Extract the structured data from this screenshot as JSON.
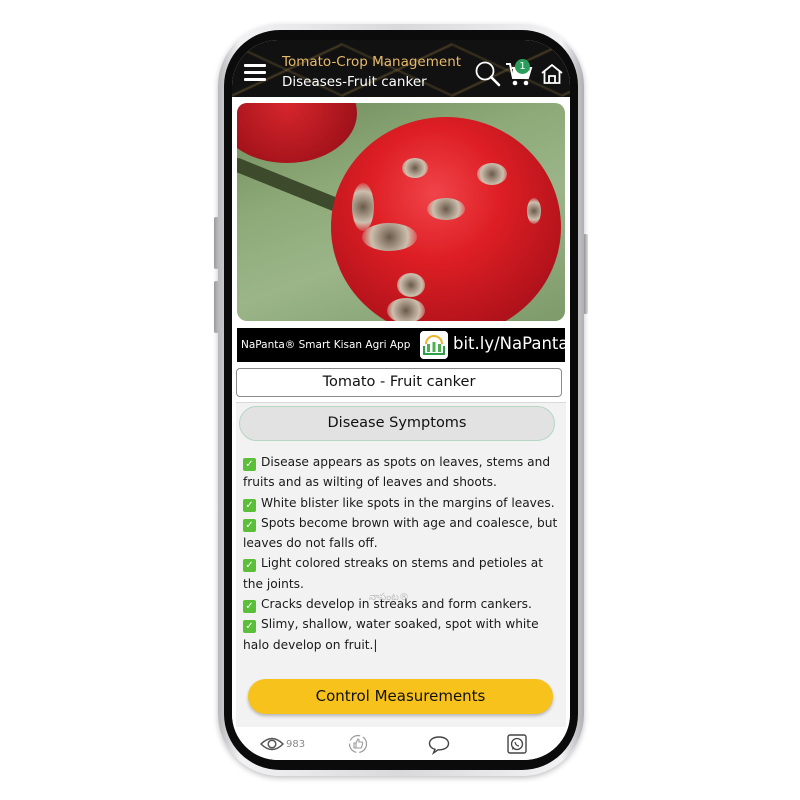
{
  "header": {
    "title": "Tomato-Crop Management",
    "subtitle": "Diseases-Fruit canker",
    "cart_count": "1",
    "icons": [
      "menu-icon",
      "search-icon",
      "cart-icon",
      "home-icon"
    ]
  },
  "banner": {
    "app_name": "NaPanta® Smart Kisan Agri App",
    "link": "bit.ly/NaPanta"
  },
  "page": {
    "disease_title": "Tomato - Fruit canker",
    "section_button": "Disease Symptoms",
    "symptoms": [
      "Disease appears as spots on leaves, stems and fruits and as wilting of leaves and shoots.",
      "White blister like spots in the margins of leaves.",
      "Spots become brown with age and coalesce, but leaves do not falls off.",
      "Light colored streaks on stems and petioles at the joints.",
      "Cracks develop in streaks and form cankers.",
      "Slimy, shallow, water soaked, spot with white halo develop on fruit.|"
    ],
    "watermark": "నాపంట®",
    "control_button": "Control Measurements"
  },
  "footer": {
    "views": "983",
    "icons": [
      "eye-icon",
      "thumbs-up-icon",
      "comment-icon",
      "whatsapp-icon"
    ]
  },
  "colors": {
    "header_bg": "#111111",
    "title_gold": "#e8b96a",
    "badge_green": "#2a9d5c",
    "control_yellow": "#f8c21c",
    "check_green": "#5bbf3a"
  }
}
